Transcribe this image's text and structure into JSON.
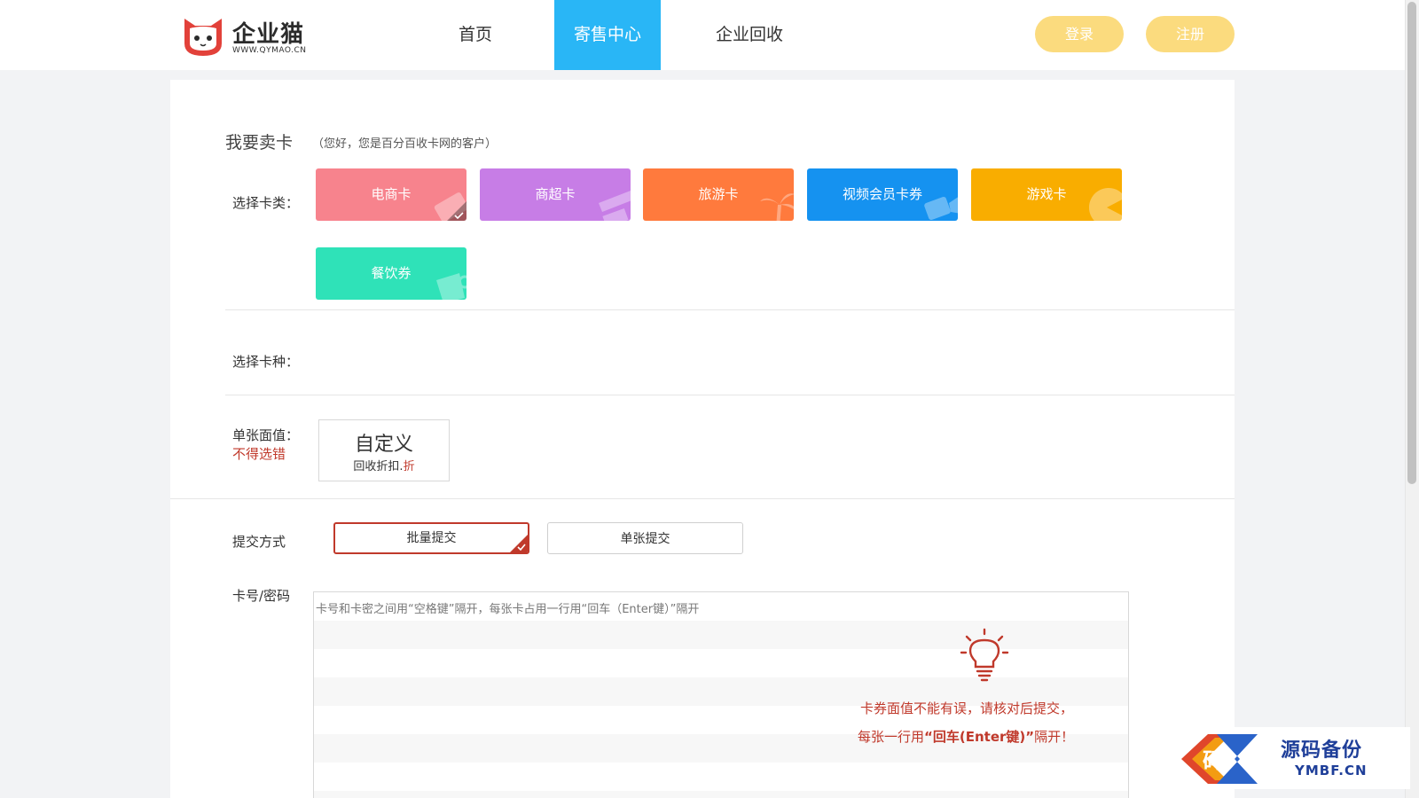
{
  "header": {
    "logo_name": "企业猫",
    "logo_url": "WWW.QYMAO.CN",
    "nav": [
      {
        "label": "首页",
        "active": false
      },
      {
        "label": "寄售中心",
        "active": true
      },
      {
        "label": "企业回收",
        "active": false
      }
    ],
    "login_label": "登录",
    "register_label": "注册"
  },
  "form": {
    "title": "我要卖卡",
    "subtitle": "（您好，您是百分百收卡网的客户）",
    "card_type_label": "选择卡类：",
    "card_types": [
      {
        "label": "电商卡",
        "color": "#f7838d",
        "icon": "ticket-icon",
        "selected": true
      },
      {
        "label": "商超卡",
        "color": "#c77de6",
        "icon": "shop-awning-icon",
        "selected": false
      },
      {
        "label": "旅游卡",
        "color": "#ff7a3d",
        "icon": "palm-tree-icon",
        "selected": false
      },
      {
        "label": "视频会员卡券",
        "color": "#1592f0",
        "icon": "video-camera-icon",
        "selected": false
      },
      {
        "label": "游戏卡",
        "color": "#f9ad00",
        "icon": "pacman-icon",
        "selected": false
      },
      {
        "label": "餐饮券",
        "color": "#2fe2b8",
        "icon": "coffee-cup-icon",
        "selected": false
      }
    ],
    "card_kind_label": "选择卡种：",
    "face_value_label": "单张面值：",
    "face_value_warning": "不得选错",
    "face_value_option": {
      "title": "自定义",
      "sub": "回收折扣.",
      "unit": "折"
    },
    "submit_mode_label": "提交方式",
    "submit_modes": [
      {
        "label": "批量提交",
        "selected": true
      },
      {
        "label": "单张提交",
        "selected": false
      }
    ],
    "card_pwd_label": "卡号/密码",
    "card_pwd_placeholder": "卡号和卡密之间用“空格键”隔开，每张卡占用一行用“回车（Enter键）”隔开",
    "tip_line1": "卡券面值不能有误，请核对后提交，",
    "tip_line2_prefix": "每张一行用",
    "tip_line2_em": "“回车(Enter键)”",
    "tip_line2_suffix": "隔开！"
  },
  "watermark": {
    "title": "源码备份",
    "url": "YMBF.CN",
    "logo_char": "码"
  },
  "colors": {
    "accent": "#29b6f6",
    "pill": "#fbdb7e",
    "warning": "#c0392b"
  }
}
